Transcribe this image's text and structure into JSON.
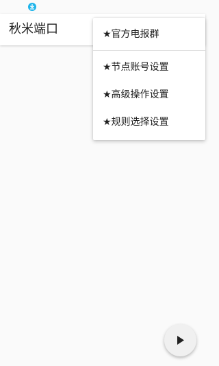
{
  "status_bar": {
    "icon": "download-icon",
    "icon_color": "#1eb4ea"
  },
  "app_bar": {
    "title": "秋米端口"
  },
  "menu": {
    "items": [
      {
        "label": "★官方电报群"
      },
      {
        "label": "★节点账号设置"
      },
      {
        "label": "★高级操作设置"
      },
      {
        "label": "★规则选择设置"
      }
    ]
  },
  "fab": {
    "icon": "play-icon"
  }
}
